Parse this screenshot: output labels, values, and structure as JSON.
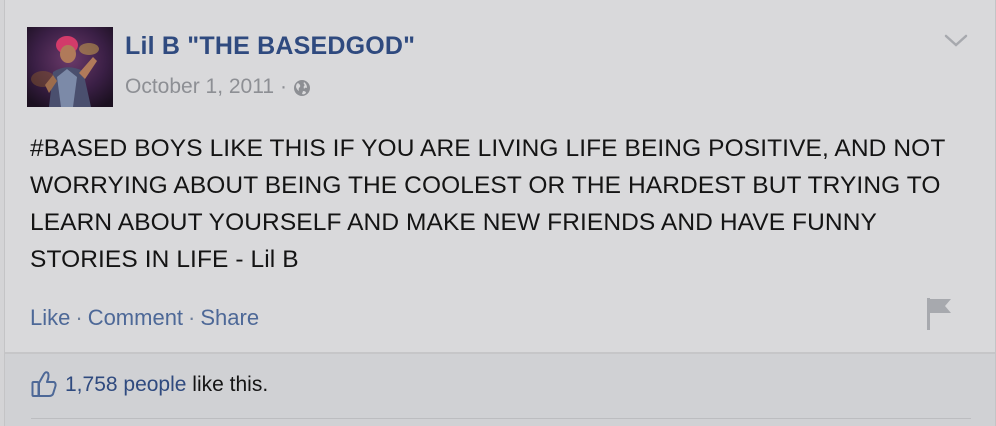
{
  "post": {
    "author_name": "Lil B \"THE BASEDGOD\"",
    "date": "October 1, 2011",
    "meta_separator": "·",
    "audience_icon": "globe-icon",
    "options_icon": "chevron-down-icon",
    "text": "#BASED BOYS LIKE THIS IF YOU ARE LIVING LIFE BEING POSITIVE, AND NOT WORRYING ABOUT BEING THE COOLEST OR THE HARDEST BUT TRYING TO LEARN ABOUT YOURSELF AND MAKE NEW FRIENDS AND HAVE FUNNY STORIES IN LIFE - Lil B"
  },
  "actions": {
    "like_label": "Like",
    "comment_label": "Comment",
    "share_label": "Share",
    "separator": "·",
    "report_icon": "flag-icon"
  },
  "likes": {
    "icon": "thumbs-up-icon",
    "count_text": "1,758 people",
    "suffix_text": "like this."
  },
  "colors": {
    "link_blue": "#2f4a7f",
    "action_blue": "#4d6897",
    "meta_gray": "#8d8f94",
    "card_bg": "#d9d9db",
    "footer_bg": "#d0d1d4"
  }
}
